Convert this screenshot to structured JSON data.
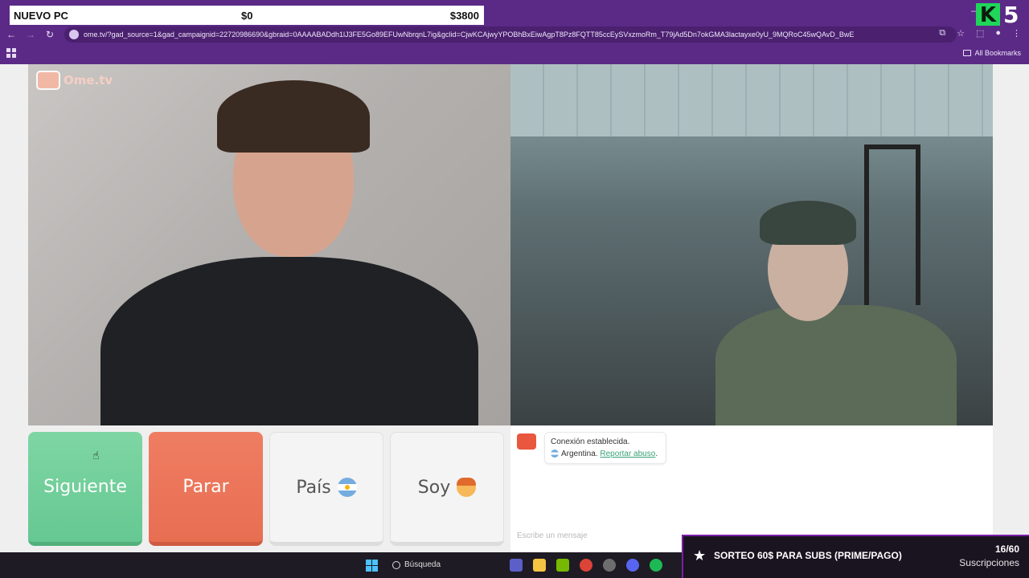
{
  "overlay": {
    "title": "NUEVO PC",
    "current": "$0",
    "goal": "$3800"
  },
  "browser": {
    "url": "ome.tv/?gad_source=1&gad_campaignid=22720986690&gbraid=0AAAABADdh1lJ3FE5Go89EFUwNbrqnL7ig&gclid=CjwKCAjwyYPOBhBxEiwAgpT8Pz8FQTT85ccEySVxzmoRm_T79jAd5Dn7okGMA3lactayxe0yU_9MQRoC45wQAvD_BwE",
    "bookmarks_label": "All Bookmarks"
  },
  "site": {
    "logo_text": "Ome.tv"
  },
  "buttons": {
    "next": "Siguiente",
    "stop": "Parar",
    "country": "País",
    "gender": "Soy"
  },
  "chat": {
    "status": "Conexión establecida.",
    "country": "Argentina.",
    "report": "Reportar abuso",
    "report_suffix": ".",
    "placeholder": "Escribe un mensaje"
  },
  "stream": {
    "giveaway": "SORTEO 60$ PARA SUBS (PRIME/PAGO)",
    "count": "16/60",
    "label": "Suscripciones"
  },
  "taskbar": {
    "search": "Búsqueda"
  },
  "colors": {
    "next": "#6fcf97",
    "stop": "#eb7459",
    "accent": "#5b2a86"
  }
}
